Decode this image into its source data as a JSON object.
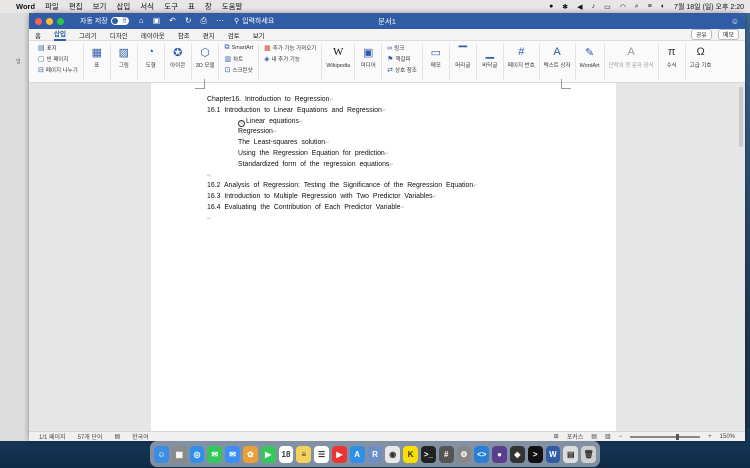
{
  "menubar": {
    "app_name": "Word",
    "items": [
      "파일",
      "편집",
      "보기",
      "삽입",
      "서식",
      "도구",
      "표",
      "창",
      "도움말"
    ],
    "clock": "7월 18일 (일) 오후 2:20"
  },
  "titlebar": {
    "autosave_label": "자동 저장",
    "autosave_state": "끔",
    "doc_title": "문서1",
    "search_placeholder": "입력하세요"
  },
  "tabs": [
    "홈",
    "삽입",
    "그리기",
    "디자인",
    "레이아웃",
    "참조",
    "편지",
    "검토",
    "보기"
  ],
  "active_tab": "삽입",
  "share_label": "공유",
  "comment_label": "메모",
  "ribbon": {
    "pages_group": [
      "표지",
      "빈 페이지",
      "페이지 나누기"
    ],
    "table_label": "표",
    "picture_label": "그림",
    "shapes_label": "도형",
    "icons_label": "아이콘",
    "model3d_label": "3D 모델",
    "smart_group": [
      "SmartArt",
      "차트",
      "스크린샷"
    ],
    "addin_group": [
      "추가 기능 가져오기",
      "내 추가 기능"
    ],
    "wikipedia_label": "Wikipedia",
    "media_label": "미디어",
    "links_group": [
      "링크",
      "책갈피",
      "상호 참조"
    ],
    "comment_label": "메모",
    "header_label": "머리글",
    "footer_label": "바닥글",
    "pagenum_label": "페이지 번호",
    "textbox_label": "텍스트 상자",
    "wordart_label": "WordArt",
    "dropcap_label": "단락의 첫 문자 장식",
    "equation_label": "수식",
    "symbol_label": "고급 기호"
  },
  "document": {
    "lines": [
      {
        "text": "Chapter16.  Introduction  to  Regression",
        "indent": false,
        "bullet": false
      },
      {
        "text": "16.1  Introduction  to  Linear  Equations  and  Regression",
        "indent": false,
        "bullet": false
      },
      {
        "text": "Linear  equations",
        "indent": true,
        "bullet": true
      },
      {
        "text": "Regression",
        "indent": true,
        "bullet": false
      },
      {
        "text": "The  Least-squares  solution",
        "indent": true,
        "bullet": false
      },
      {
        "text": "Using  the  Regression  Equation  for  prediction",
        "indent": true,
        "bullet": false
      },
      {
        "text": "Standardized  form  of  the  regression  equations",
        "indent": true,
        "bullet": false
      },
      {
        "text": "",
        "indent": false,
        "bullet": false
      },
      {
        "text": "16.2  Analysis  of  Regression:  Testing  the  Significance  of  the  Regression  Equation",
        "indent": false,
        "bullet": false
      },
      {
        "text": "16.3  Introduction  to  Multiple  Regression  with  Two  Predictor  Variables",
        "indent": false,
        "bullet": false
      },
      {
        "text": "16.4  Evaluating  the  Contribution  of  Each  Predictor  Variable",
        "indent": false,
        "bullet": false
      },
      {
        "text": "",
        "indent": false,
        "bullet": false
      }
    ]
  },
  "statusbar": {
    "page": "1/1 페이지",
    "words": "57개 단어",
    "language": "한국어",
    "focus": "포커스",
    "zoom": "150%"
  },
  "dock": {
    "apps": [
      {
        "name": "finder",
        "color": "#3b8de0",
        "glyph": "☺"
      },
      {
        "name": "launchpad",
        "color": "#8a8a8a",
        "glyph": "▦"
      },
      {
        "name": "safari",
        "color": "#2f8fe8",
        "glyph": "◎"
      },
      {
        "name": "messages",
        "color": "#34c759",
        "glyph": "✉"
      },
      {
        "name": "mail",
        "color": "#3a8ef5",
        "glyph": "✉"
      },
      {
        "name": "photos",
        "color": "#e8a13a",
        "glyph": "✿"
      },
      {
        "name": "facetime",
        "color": "#34c759",
        "glyph": "▶"
      },
      {
        "name": "calendar",
        "color": "#ffffff",
        "glyph": "18"
      },
      {
        "name": "notes",
        "color": "#f5d25a",
        "glyph": "≡"
      },
      {
        "name": "reminders",
        "color": "#ffffff",
        "glyph": "☰"
      },
      {
        "name": "youtube",
        "color": "#e33",
        "glyph": "▶"
      },
      {
        "name": "appstore",
        "color": "#2f8fe8",
        "glyph": "A"
      },
      {
        "name": "r-app",
        "color": "#6c8fc7",
        "glyph": "R"
      },
      {
        "name": "chrome",
        "color": "#e8e8e8",
        "glyph": "◉"
      },
      {
        "name": "kakaotalk",
        "color": "#f9e000",
        "glyph": "K"
      },
      {
        "name": "terminal",
        "color": "#222",
        "glyph": ">_"
      },
      {
        "name": "calculator",
        "color": "#555",
        "glyph": "#"
      },
      {
        "name": "settings",
        "color": "#888",
        "glyph": "⚙"
      },
      {
        "name": "vscode",
        "color": "#2a7fd4",
        "glyph": "<>"
      },
      {
        "name": "github",
        "color": "#5a3e8e",
        "glyph": "●"
      },
      {
        "name": "unity",
        "color": "#333",
        "glyph": "◆"
      },
      {
        "name": "terminal2",
        "color": "#111",
        "glyph": ">"
      },
      {
        "name": "word",
        "color": "#2f5ca5",
        "glyph": "W"
      },
      {
        "name": "preview",
        "color": "#ddd",
        "glyph": "▤"
      },
      {
        "name": "trash",
        "color": "#cfcfcf",
        "glyph": "🗑"
      }
    ]
  }
}
